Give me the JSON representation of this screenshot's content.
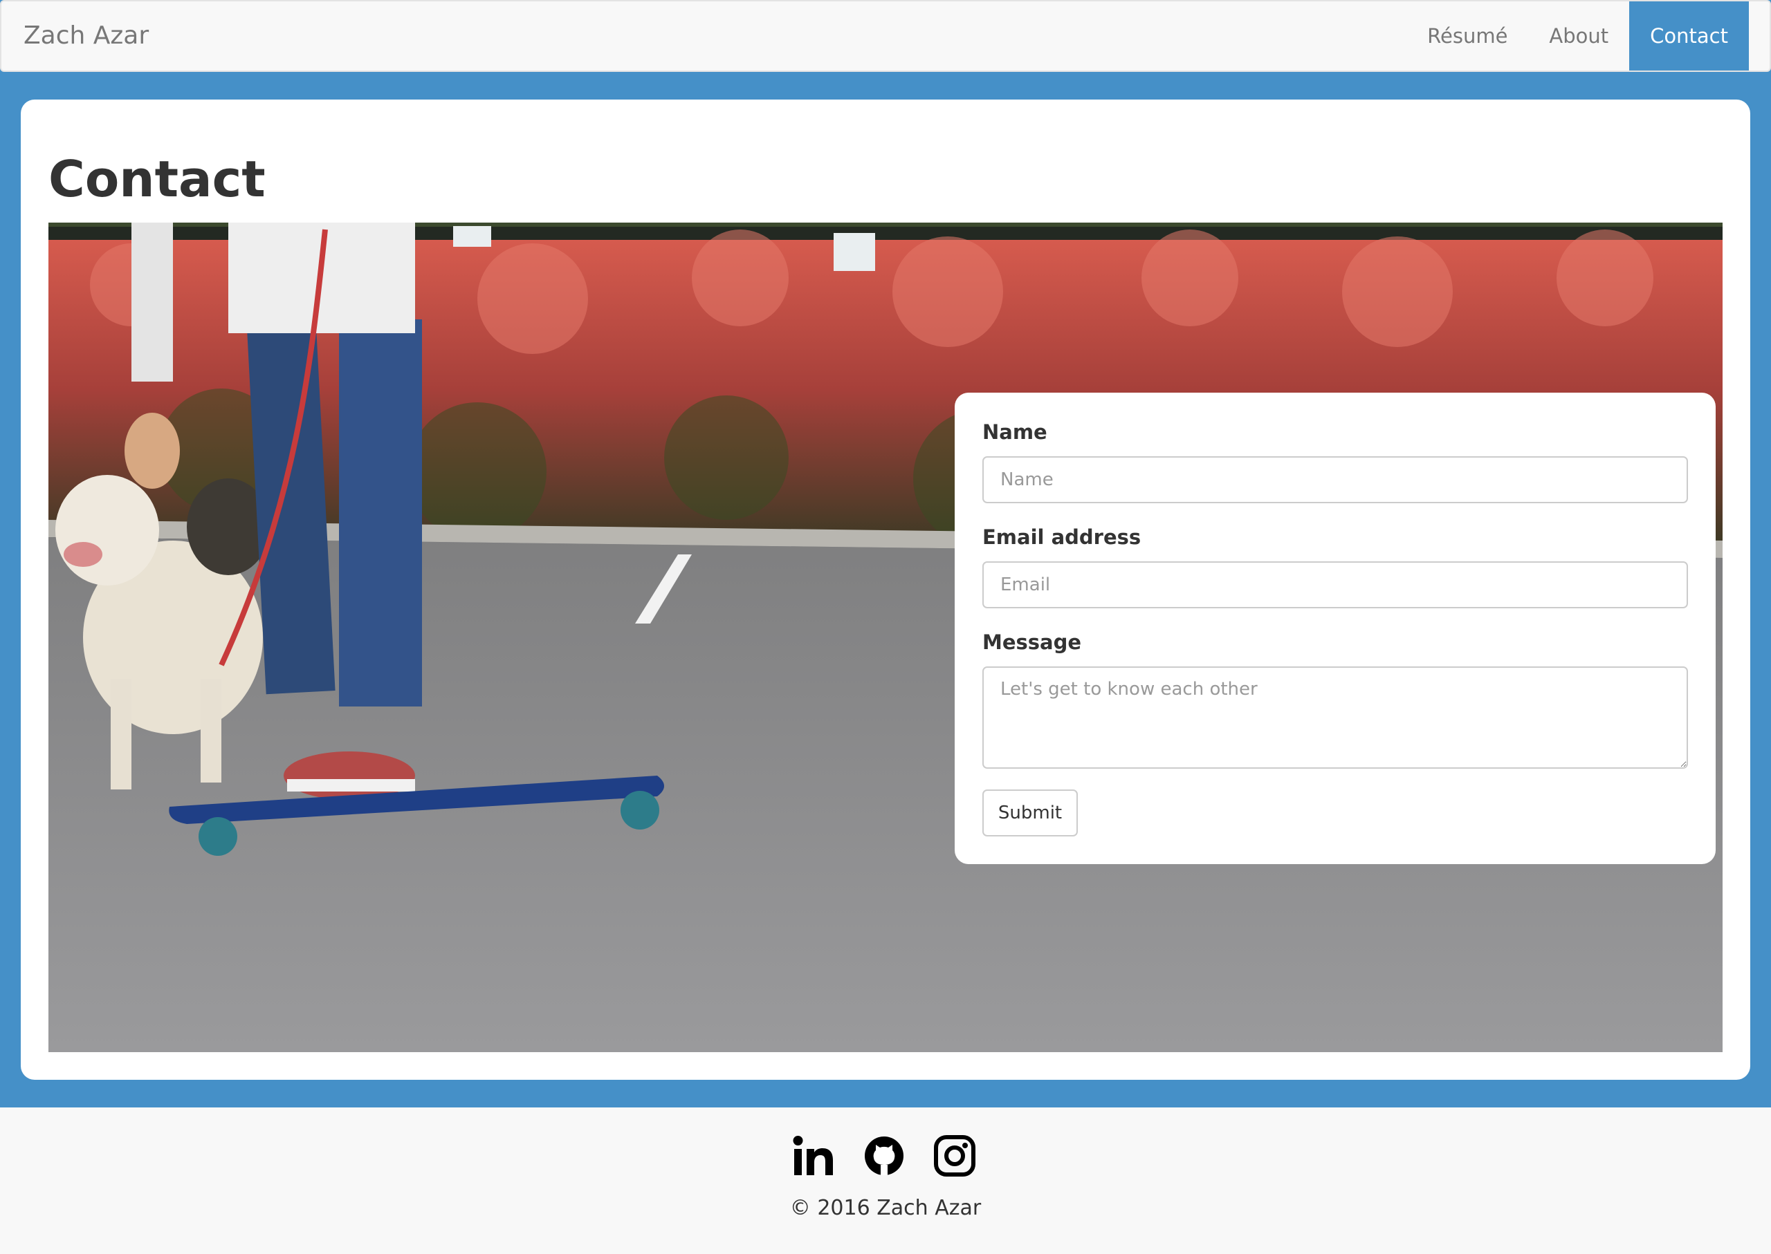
{
  "navbar": {
    "brand": "Zach Azar",
    "links": [
      {
        "label": "Résumé"
      },
      {
        "label": "About"
      },
      {
        "label": "Contact",
        "active": true
      }
    ]
  },
  "page": {
    "title": "Contact"
  },
  "hero": {
    "description_icon": "photo-icon"
  },
  "form": {
    "name_label": "Name",
    "name_placeholder": "Name",
    "name_value": "",
    "email_label": "Email address",
    "email_placeholder": "Email",
    "email_value": "",
    "message_label": "Message",
    "message_placeholder": "Let's get to know each other",
    "message_value": "",
    "submit_label": "Submit"
  },
  "footer": {
    "social": [
      {
        "icon": "linkedin-icon"
      },
      {
        "icon": "github-icon"
      },
      {
        "icon": "instagram-icon"
      }
    ],
    "copyright": "© 2016 Zach Azar"
  },
  "colors": {
    "accent": "#4590c8",
    "navbar_bg": "#f8f8f8",
    "panel_bg": "#ffffff",
    "text": "#333333",
    "muted": "#777777"
  }
}
